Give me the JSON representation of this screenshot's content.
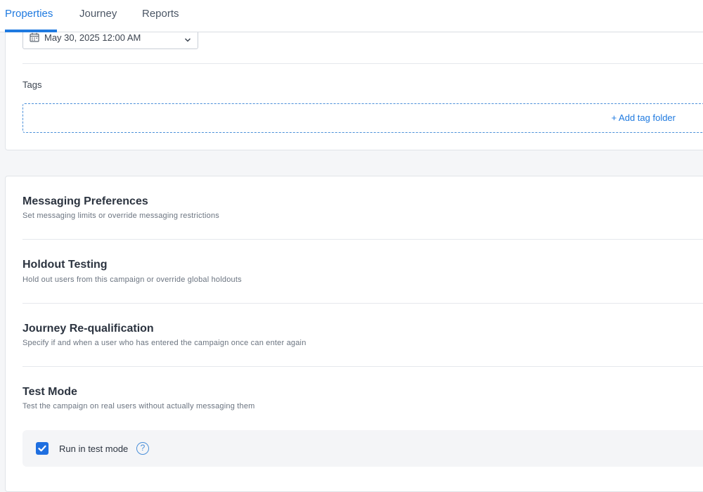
{
  "tabs": [
    {
      "label": "Properties",
      "active": true
    },
    {
      "label": "Journey",
      "active": false
    },
    {
      "label": "Reports",
      "active": false
    }
  ],
  "schedule": {
    "date_value": "May 30, 2025 12:00 AM",
    "calendar_icon": "calendar-icon",
    "dropdown_icon": "chevron-down-icon"
  },
  "tags": {
    "label": "Tags",
    "add_label": "+ Add tag folder"
  },
  "sections": [
    {
      "title": "Messaging Preferences",
      "description": "Set messaging limits or override messaging restrictions"
    },
    {
      "title": "Holdout Testing",
      "description": "Hold out users from this campaign or override global holdouts"
    },
    {
      "title": "Journey Re-qualification",
      "description": "Specify if and when a user who has entered the campaign once can enter again"
    },
    {
      "title": "Test Mode",
      "description": "Test the campaign on real users without actually messaging them"
    }
  ],
  "test_mode": {
    "checkbox_label": "Run in test mode",
    "checked": true,
    "help_glyph": "?"
  },
  "colors": {
    "accent": "#1f7ae0",
    "checkbox": "#1f6fe0",
    "background": "#f5f6f8"
  }
}
